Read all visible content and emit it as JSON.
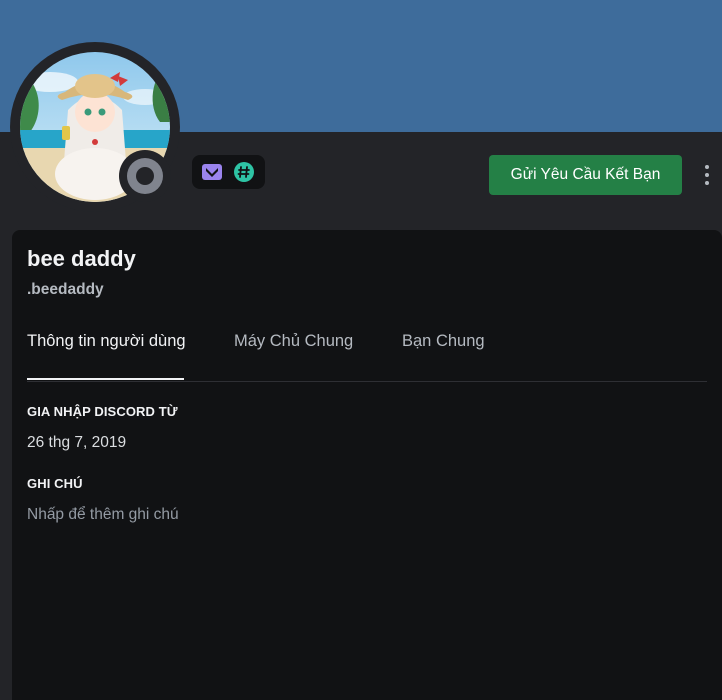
{
  "colors": {
    "banner": "#3e6c9b",
    "add_friend_button": "#248046",
    "status_offline": "#80848e",
    "badge_nitro": "#9b84ee",
    "badge_hashtag": "#2ec4a5"
  },
  "badges": [
    {
      "icon": "nitro-chevron-icon"
    },
    {
      "icon": "hashtag-icon"
    }
  ],
  "actions": {
    "add_friend_label": "Gửi Yêu Cầu Kết Bạn",
    "more_icon": "more-vertical-icon"
  },
  "profile": {
    "display_name": "bee daddy",
    "username": ".beedaddy",
    "status": "offline"
  },
  "tabs": [
    {
      "label": "Thông tin người dùng",
      "active": true
    },
    {
      "label": "Máy Chủ Chung",
      "active": false
    },
    {
      "label": "Bạn Chung",
      "active": false
    }
  ],
  "about": {
    "member_since_title": "GIA NHẬP DISCORD TỪ",
    "member_since_value": "26 thg 7, 2019",
    "note_title": "GHI CHÚ",
    "note_placeholder": "Nhấp để thêm ghi chú"
  }
}
